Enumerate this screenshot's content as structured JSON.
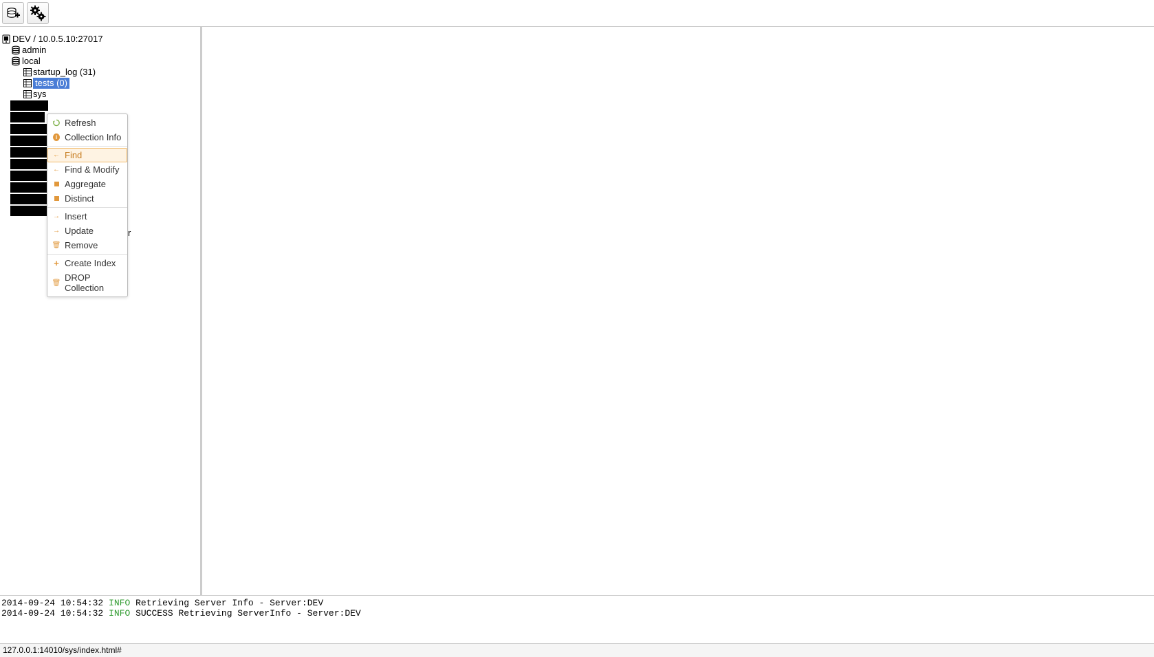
{
  "toolbar": {
    "add_connection_tooltip": "Add Connection",
    "settings_tooltip": "Settings"
  },
  "tree": {
    "server_label": "DEV / 10.0.5.10:27017",
    "db_admin": "admin",
    "db_local": "local",
    "collections": {
      "startup_log": "startup_log (31)",
      "selected_label": "tests (0)",
      "sys_prefix": "sys"
    },
    "partial_tail": "r"
  },
  "context_menu": {
    "refresh": "Refresh",
    "collection_info": "Collection Info",
    "find": "Find",
    "find_modify": "Find & Modify",
    "aggregate": "Aggregate",
    "distinct": "Distinct",
    "insert": "Insert",
    "update": "Update",
    "remove": "Remove",
    "create_index": "Create Index",
    "drop_collection": "DROP Collection"
  },
  "log": [
    {
      "time": "2014-09-24 10:54:32",
      "level": "INFO",
      "message": "Retrieving Server Info - Server:DEV"
    },
    {
      "time": "2014-09-24 10:54:32",
      "level": "INFO",
      "message": "SUCCESS Retrieving ServerInfo - Server:DEV"
    }
  ],
  "status_bar": "127.0.0.1:14010/sys/index.html#"
}
